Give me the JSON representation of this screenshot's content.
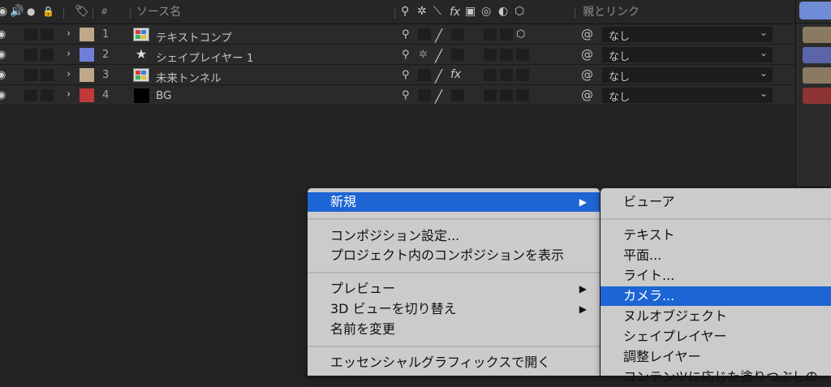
{
  "header": {
    "hash_label": "#",
    "source_name_label": "ソース名",
    "fx_label": "fx",
    "parent_link_label": "親とリンク"
  },
  "layers": [
    {
      "num": "1",
      "name": "テキストコンプ",
      "color": "#bfa889",
      "icon": "composition-icon",
      "parent": "なし",
      "fx": ""
    },
    {
      "num": "2",
      "name": "シェイプレイヤー 1",
      "color": "#6f7fd8",
      "icon": "star-icon",
      "parent": "なし",
      "fx": ""
    },
    {
      "num": "3",
      "name": "未来トンネル",
      "color": "#bfa889",
      "icon": "composition-icon",
      "parent": "なし",
      "fx": "fx"
    },
    {
      "num": "4",
      "name": "BG",
      "color": "#c03a3a",
      "icon": "solid-icon",
      "parent": "なし",
      "fx": ""
    }
  ],
  "context_menu": {
    "new": "新規",
    "composition_settings": "コンポジション設定...",
    "show_in_project": "プロジェクト内のコンポジションを表示",
    "preview": "プレビュー",
    "toggle_3d_view": "3D ビューを切り替え",
    "rename": "名前を変更",
    "open_essential_graphics": "エッセンシャルグラフィックスで開く"
  },
  "submenu": {
    "viewer": "ビューア",
    "text": "テキスト",
    "solid": "平面...",
    "light": "ライト...",
    "camera": "カメラ...",
    "null_object": "ヌルオブジェクト",
    "shape_layer": "シェイプレイヤー",
    "adjustment_layer": "調整レイヤー",
    "content_aware_fill": "コンテンツに応じた塗りつぶしの"
  }
}
